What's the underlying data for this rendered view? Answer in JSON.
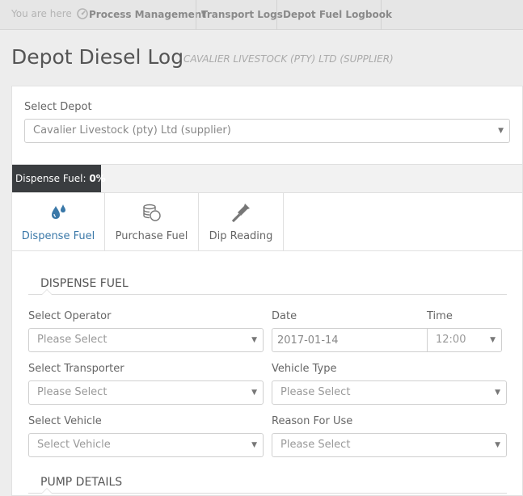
{
  "breadcrumb": {
    "prefix": "You are here",
    "icon": "dashboard-gauge-icon",
    "items": [
      "Process Management",
      "Transport Logs",
      "Depot Fuel Logbook"
    ]
  },
  "page": {
    "title": "Depot Diesel Log",
    "subtitle": "CAVALIER LIVESTOCK (PTY) LTD (SUPPLIER)"
  },
  "depot": {
    "label": "Select Depot",
    "value": "Cavalier Livestock (pty) Ltd (supplier)"
  },
  "progress": {
    "label": "Dispense Fuel:",
    "value": "0%"
  },
  "tabs": [
    {
      "label": "Dispense Fuel",
      "icon": "fuel-drops-icon",
      "active": true
    },
    {
      "label": "Purchase Fuel",
      "icon": "coins-icon",
      "active": false
    },
    {
      "label": "Dip Reading",
      "icon": "dropper-icon",
      "active": false
    }
  ],
  "dispense": {
    "heading": "DISPENSE FUEL",
    "operator": {
      "label": "Select Operator",
      "value": "Please Select"
    },
    "date": {
      "label": "Date",
      "value": "2017-01-14"
    },
    "time": {
      "label": "Time",
      "value": "12:00"
    },
    "transporter": {
      "label": "Select Transporter",
      "value": "Please Select"
    },
    "vehicle_type": {
      "label": "Vehicle Type",
      "value": "Please Select"
    },
    "vehicle": {
      "label": "Select Vehicle",
      "value": "Select Vehicle"
    },
    "reason": {
      "label": "Reason For Use",
      "value": "Please Select"
    }
  },
  "pump": {
    "heading": "PUMP DETAILS"
  },
  "colors": {
    "accent": "#3a78a8",
    "progress_bg": "#3a3d40"
  }
}
